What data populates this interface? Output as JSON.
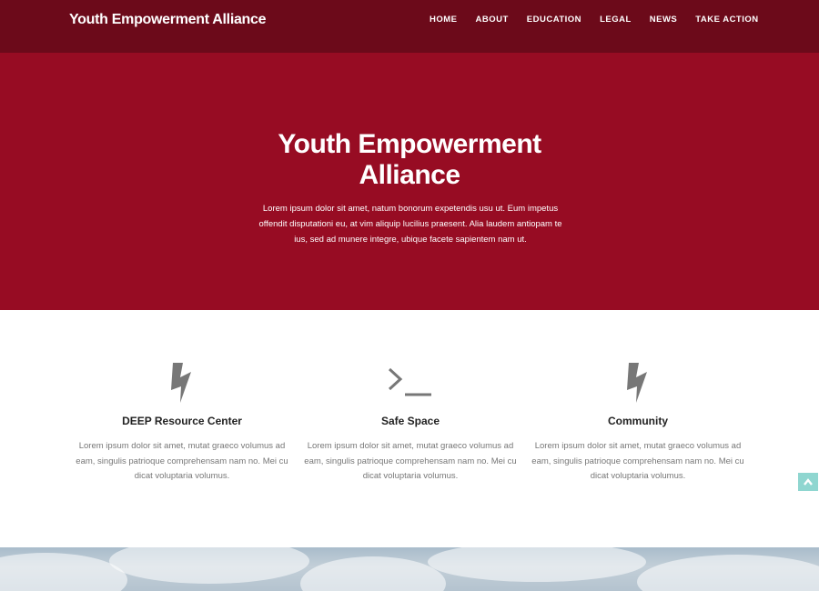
{
  "header": {
    "brand": "Youth Empowerment Alliance",
    "nav": [
      "HOME",
      "ABOUT",
      "EDUCATION",
      "LEGAL",
      "NEWS",
      "TAKE ACTION"
    ]
  },
  "hero": {
    "title": "Youth Empowerment Alliance",
    "text": "Lorem ipsum dolor sit amet, natum bonorum expetendis usu ut. Eum impetus offendit disputationi eu, at vim aliquip lucilius praesent. Alia laudem antiopam te ius, sed ad munere integre, ubique facete sapientem nam ut."
  },
  "features": [
    {
      "icon": "lightning-bolt-icon",
      "title": "DEEP Resource Center",
      "text": "Lorem ipsum dolor sit amet, mutat graeco volumus ad eam, singulis patrioque comprehensam nam no. Mei cu dicat voluptaria volumus."
    },
    {
      "icon": "terminal-icon",
      "title": "Safe Space",
      "text": "Lorem ipsum dolor sit amet, mutat graeco volumus ad eam, singulis patrioque comprehensam nam no. Mei cu dicat voluptaria volumus."
    },
    {
      "icon": "lightning-bolt-icon",
      "title": "Community",
      "text": "Lorem ipsum dolor sit amet, mutat graeco volumus ad eam, singulis patrioque comprehensam nam no. Mei cu dicat voluptaria volumus."
    }
  ],
  "colors": {
    "navbar": "#6c0a1a",
    "hero": "#970c23",
    "icon": "#777777",
    "scroll_top": "#8fd6d0"
  },
  "scroll_top": {
    "icon": "chevron-up-icon"
  }
}
